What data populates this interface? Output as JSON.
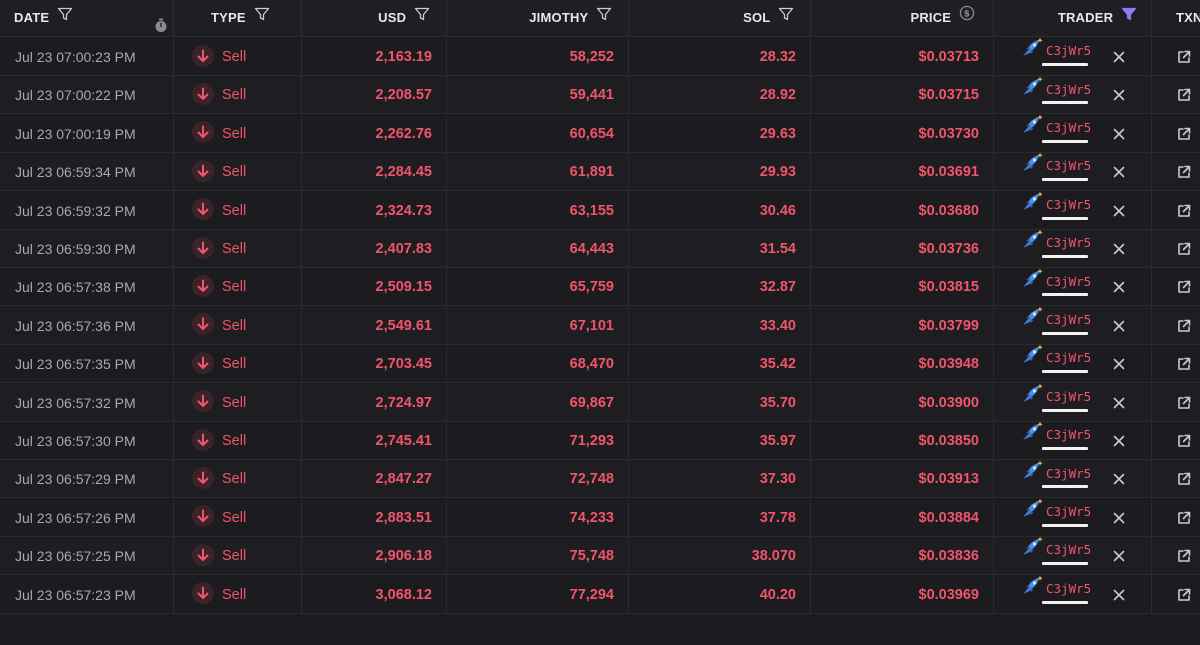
{
  "columns": {
    "date": "DATE",
    "type": "TYPE",
    "usd": "USD",
    "jimothy": "JIMOTHY",
    "sol": "SOL",
    "price": "PRICE",
    "trader": "TRADER",
    "txn": "TXN"
  },
  "icons": {
    "filter": "filter-icon",
    "filter_active": "filter-active-icon",
    "timer": "stopwatch-icon",
    "price_coin": "dollar-coin-icon",
    "sell": "arrow-down-icon",
    "trader": "rocket-sparkle-icon",
    "remove": "close-icon",
    "open": "external-link-icon"
  },
  "colors": {
    "sell": "#f0556a",
    "filter_active": "#8b7cf6",
    "background": "#1b1b20"
  },
  "rows": [
    {
      "date": "Jul 23 07:00:23 PM",
      "type": "Sell",
      "usd": "2,163.19",
      "jimothy": "58,252",
      "sol": "28.32",
      "price": "$0.03713",
      "trader": "C3jWr5"
    },
    {
      "date": "Jul 23 07:00:22 PM",
      "type": "Sell",
      "usd": "2,208.57",
      "jimothy": "59,441",
      "sol": "28.92",
      "price": "$0.03715",
      "trader": "C3jWr5"
    },
    {
      "date": "Jul 23 07:00:19 PM",
      "type": "Sell",
      "usd": "2,262.76",
      "jimothy": "60,654",
      "sol": "29.63",
      "price": "$0.03730",
      "trader": "C3jWr5"
    },
    {
      "date": "Jul 23 06:59:34 PM",
      "type": "Sell",
      "usd": "2,284.45",
      "jimothy": "61,891",
      "sol": "29.93",
      "price": "$0.03691",
      "trader": "C3jWr5"
    },
    {
      "date": "Jul 23 06:59:32 PM",
      "type": "Sell",
      "usd": "2,324.73",
      "jimothy": "63,155",
      "sol": "30.46",
      "price": "$0.03680",
      "trader": "C3jWr5"
    },
    {
      "date": "Jul 23 06:59:30 PM",
      "type": "Sell",
      "usd": "2,407.83",
      "jimothy": "64,443",
      "sol": "31.54",
      "price": "$0.03736",
      "trader": "C3jWr5"
    },
    {
      "date": "Jul 23 06:57:38 PM",
      "type": "Sell",
      "usd": "2,509.15",
      "jimothy": "65,759",
      "sol": "32.87",
      "price": "$0.03815",
      "trader": "C3jWr5"
    },
    {
      "date": "Jul 23 06:57:36 PM",
      "type": "Sell",
      "usd": "2,549.61",
      "jimothy": "67,101",
      "sol": "33.40",
      "price": "$0.03799",
      "trader": "C3jWr5"
    },
    {
      "date": "Jul 23 06:57:35 PM",
      "type": "Sell",
      "usd": "2,703.45",
      "jimothy": "68,470",
      "sol": "35.42",
      "price": "$0.03948",
      "trader": "C3jWr5"
    },
    {
      "date": "Jul 23 06:57:32 PM",
      "type": "Sell",
      "usd": "2,724.97",
      "jimothy": "69,867",
      "sol": "35.70",
      "price": "$0.03900",
      "trader": "C3jWr5"
    },
    {
      "date": "Jul 23 06:57:30 PM",
      "type": "Sell",
      "usd": "2,745.41",
      "jimothy": "71,293",
      "sol": "35.97",
      "price": "$0.03850",
      "trader": "C3jWr5"
    },
    {
      "date": "Jul 23 06:57:29 PM",
      "type": "Sell",
      "usd": "2,847.27",
      "jimothy": "72,748",
      "sol": "37.30",
      "price": "$0.03913",
      "trader": "C3jWr5"
    },
    {
      "date": "Jul 23 06:57:26 PM",
      "type": "Sell",
      "usd": "2,883.51",
      "jimothy": "74,233",
      "sol": "37.78",
      "price": "$0.03884",
      "trader": "C3jWr5"
    },
    {
      "date": "Jul 23 06:57:25 PM",
      "type": "Sell",
      "usd": "2,906.18",
      "jimothy": "75,748",
      "sol": "38.070",
      "price": "$0.03836",
      "trader": "C3jWr5"
    },
    {
      "date": "Jul 23 06:57:23 PM",
      "type": "Sell",
      "usd": "3,068.12",
      "jimothy": "77,294",
      "sol": "40.20",
      "price": "$0.03969",
      "trader": "C3jWr5"
    }
  ]
}
